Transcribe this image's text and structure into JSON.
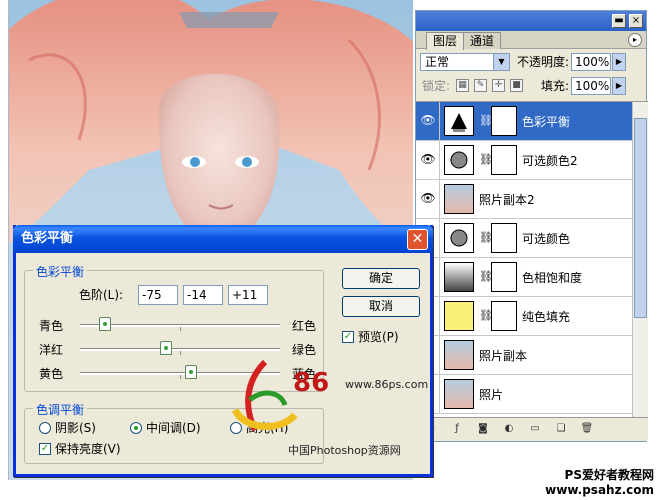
{
  "layers_panel": {
    "tabs": [
      "图层",
      "通道"
    ],
    "blend_mode": "正常",
    "opacity_label": "不透明度:",
    "opacity_value": "100%",
    "lock_label": "锁定:",
    "fill_label": "填充:",
    "fill_value": "100%",
    "layers": [
      {
        "name": "色彩平衡",
        "type": "adjustment",
        "visible": true,
        "selected": true
      },
      {
        "name": "可选颜色2",
        "type": "adjustment",
        "visible": true,
        "selected": false
      },
      {
        "name": "照片副本2",
        "type": "photo",
        "visible": true,
        "selected": false
      },
      {
        "name": "可选颜色",
        "type": "adjustment",
        "visible": false,
        "selected": false
      },
      {
        "name": "色相饱和度",
        "type": "adjustment",
        "visible": false,
        "selected": false
      },
      {
        "name": "纯色填充",
        "type": "fill",
        "visible": false,
        "selected": false
      },
      {
        "name": "照片副本",
        "type": "photo",
        "visible": false,
        "selected": false
      },
      {
        "name": "照片",
        "type": "photo",
        "visible": false,
        "selected": false
      }
    ]
  },
  "dialog": {
    "title": "色彩平衡",
    "balance_group": "色彩平衡",
    "levels_label": "色阶(L):",
    "levels": [
      "-75",
      "-14",
      "+11"
    ],
    "sliders": [
      {
        "left": "青色",
        "right": "红色",
        "value": -75
      },
      {
        "left": "洋红",
        "right": "绿色",
        "value": -14
      },
      {
        "left": "黄色",
        "right": "蓝色",
        "value": 11
      }
    ],
    "tone_group": "色调平衡",
    "tones": [
      "阴影(S)",
      "中间调(D)",
      "高光(H)"
    ],
    "tone_selected": 1,
    "preserve_label": "保持亮度(V)",
    "ok_label": "确定",
    "cancel_label": "取消",
    "preview_label": "预览(P)"
  },
  "watermark": {
    "logo_text": "86",
    "site": "www.86ps.com",
    "subtitle": "中国Photoshop资源网"
  },
  "footer": {
    "line1": "PS爱好者教程网",
    "line2": "www.psahz.com"
  },
  "colors": {
    "accent": "#316ac5",
    "title_blue": "#0a55e0",
    "group_text": "#0046d5",
    "fill_swatch": "#fbf07a"
  }
}
